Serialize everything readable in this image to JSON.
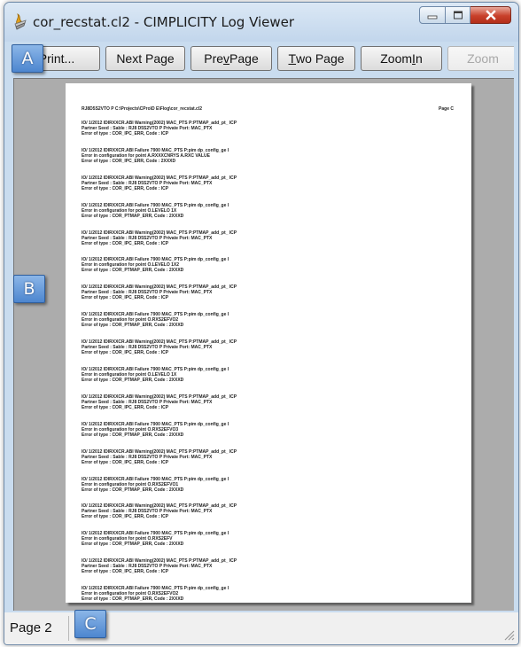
{
  "window": {
    "title": "cor_recstat.cl2 - CIMPLICITY Log Viewer"
  },
  "toolbar": {
    "print": "Print...",
    "next_page": "Next Page",
    "prev_page_a": "Pre",
    "prev_page_u": "v",
    "prev_page_b": " Page",
    "two_page_u": "T",
    "two_page_b": "wo Page",
    "zoom_in_a": "Zoom ",
    "zoom_in_u": "I",
    "zoom_in_b": "n",
    "zoom_out": "Zoom"
  },
  "page": {
    "header_path": "RJ8D5S2VTO P C:\\Projects\\CPro\\D E\\Flog\\cor_recstat.cl2",
    "header_page": "Page C",
    "entries": [
      {
        "line1": "IO/ 1/2012  IDIRXXCR.ABI  Warning(2002)        MAC_PTS P:PTMAP_add_pt_  ICP",
        "line2": "Partner Seed : Sable :    RJ8 D5S2VTO P  Private Port:   MAC_PTX",
        "line3": "Error of type : COR_IPC_ERR,  Code : ICP"
      },
      {
        "line1": "IO/ 1/2012  IDIRXXCR.ABI  Failure  7900        MAC_PTS P:pim dp_config_ge  I",
        "line2": "Error in configuration for point  A.RXXXCNRYS A.RXC VALUE",
        "line3": "Error of type : COR_IPC_ERR,  Code : 2XXXD"
      },
      {
        "line1": "IO/ 1/2012  IDIRXXCR.ABI  Warning(2002)        MAC_PTS P:PTMAP_add_pt_  ICP",
        "line2": "Partner Seed : Sable :    RJ8 D5S2VTO P  Private Port:   MAC_PTX",
        "line3": "Error of type : COR_IPC_ERR,  Code : ICP"
      },
      {
        "line1": "IO/ 1/2012  IDIRXXCR.ABI  Failure  7900        MAC_PTS P:pim dp_config_ge  I",
        "line2": "Error in configuration for point  O.LEVELO 1X",
        "line3": "Error of type : COR_PTMAP_ERR,  Code : 2XXXD"
      },
      {
        "line1": "IO/ 1/2012  IDIRXXCR.ABI  Warning(2002)        MAC_PTS P:PTMAP_add_pt_  ICP",
        "line2": "Partner Seed : Sable :    RJ8 D5S2VTO P  Private Port:   MAC_PTX",
        "line3": "Error of type : COR_IPC_ERR,  Code : ICP"
      },
      {
        "line1": "IO/ 1/2012  IDIRXXCR.ABI  Failure  7900        MAC_PTS P:pim dp_config_ge  I",
        "line2": "Error in configuration for point  O.LEVELO 1X2",
        "line3": "Error of type : COR_PTMAP_ERR,  Code : 2XXXD"
      },
      {
        "line1": "IO/ 1/2012  IDIRXXCR.ABI  Warning(2002)        MAC_PTS P:PTMAP_add_pt_  ICP",
        "line2": "Partner Seed : Sable :    RJ8 D5S2VTO P  Private Port:   MAC_PTX",
        "line3": "Error of type : COR_IPC_ERR,  Code : ICP"
      },
      {
        "line1": "IO/ 1/2012  IDIRXXCR.ABI  Failure  7900        MAC_PTS P:pim dp_config_ge  I",
        "line2": "Error in configuration for point  O.RXS2EFVO2",
        "line3": "Error of type : COR_PTMAP_ERR,  Code : 2XXXD"
      },
      {
        "line1": "IO/ 1/2012  IDIRXXCR.ABI  Warning(2002)        MAC_PTS P:PTMAP_add_pt_  ICP",
        "line2": "Partner Seed : Sable :    RJ8 D5S2VTO P  Private Port:   MAC_PTX",
        "line3": "Error of type : COR_IPC_ERR,  Code : ICP"
      },
      {
        "line1": "IO/ 1/2012  IDIRXXCR.ABI  Failure  7900        MAC_PTS P:pim dp_config_ge  I",
        "line2": "Error in configuration for point  O.LEVELO 1X",
        "line3": "Error of type : COR_PTMAP_ERR,  Code : 2XXXD"
      },
      {
        "line1": "IO/ 1/2012  IDIRXXCR.ABI  Warning(2002)        MAC_PTS P:PTMAP_add_pt_  ICP",
        "line2": "Partner Seed : Sable :    RJ8 D5S2VTO P  Private Port:   MAC_PTX",
        "line3": "Error of type : COR_IPC_ERR,  Code : ICP"
      },
      {
        "line1": "IO/ 1/2012  IDIRXXCR.ABI  Failure  7900        MAC_PTS P:pim dp_config_ge  I",
        "line2": "Error in configuration for point  O.RXS2EFVO3",
        "line3": "Error of type : COR_PTMAP_ERR,  Code : 2XXXD"
      },
      {
        "line1": "IO/ 1/2012  IDIRXXCR.ABI  Warning(2002)        MAC_PTS P:PTMAP_add_pt_  ICP",
        "line2": "Partner Seed : Sable :    RJ8 D5S2VTO P  Private Port:   MAC_PTX",
        "line3": "Error of type : COR_IPC_ERR,  Code : ICP"
      },
      {
        "line1": "IO/ 1/2012  IDIRXXCR.ABI  Failure  7900        MAC_PTS P:pim dp_config_ge  I",
        "line2": "Error in configuration for point  O.RXS2EFVO1",
        "line3": "Error of type : COR_PTMAP_ERR,  Code : 2XXXD"
      },
      {
        "line1": "IO/ 1/2012  IDIRXXCR.ABI  Warning(2002)        MAC_PTS P:PTMAP_add_pt_  ICP",
        "line2": "Partner Seed : Sable :    RJ8 D5S2VTO P  Private Port:   MAC_PTX",
        "line3": "Error of type : COR_IPC_ERR,  Code : ICP"
      },
      {
        "line1": "IO/ 1/2012  IDIRXXCR.ABI  Failure  7900        MAC_PTS P:pim dp_config_ge  I",
        "line2": "Error in configuration for point  O.RXS2EFV",
        "line3": "Error of type : COR_PTMAP_ERR,  Code : 2XXXD"
      },
      {
        "line1": "IO/ 1/2012  IDIRXXCR.ABI  Warning(2002)        MAC_PTS P:PTMAP_add_pt_  ICP",
        "line2": "Partner Seed : Sable :    RJ8 D5S2VTO P  Private Port:   MAC_PTX",
        "line3": "Error of type : COR_IPC_ERR,  Code : ICP"
      },
      {
        "line1": "IO/ 1/2012  IDIRXXCR.ABI  Failure  7900        MAC_PTS P:pim dp_config_ge  I",
        "line2": "Error in configuration for point  O.RXS2EFVO2",
        "line3": "Error of type : COR_PTMAP_ERR,  Code : 2XXXD"
      },
      {
        "line1": "IO/ 1/2012  IDIRXXCR.ABI  Warning(2002)        MAC_PTS P:PTMAP_add_pt_  ICP",
        "line2": "",
        "line3": ""
      }
    ]
  },
  "markers": {
    "a": "A",
    "b": "B",
    "c": "C"
  },
  "status": {
    "page_label": "Page 2"
  }
}
